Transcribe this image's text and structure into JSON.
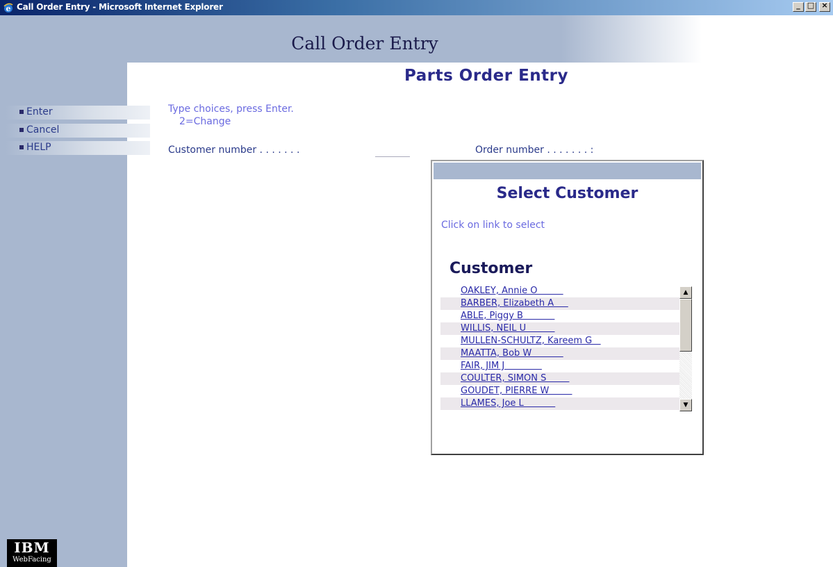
{
  "window": {
    "title": "Call Order Entry - Microsoft Internet Explorer",
    "minimize": "_",
    "maximize": "□",
    "close": "×"
  },
  "header": {
    "app_title": "Call Order Entry",
    "page_title": "Parts Order Entry"
  },
  "commands": [
    {
      "label": "Enter"
    },
    {
      "label": "Cancel"
    },
    {
      "label": "HELP"
    }
  ],
  "form": {
    "instruction_line1": "Type choices, press Enter.",
    "instruction_line2": "2=Change",
    "customer_number_label": "Customer number . . . . . . .",
    "customer_number_value": "",
    "order_number_label": "Order number . . . . . . . :"
  },
  "popup": {
    "title": "Select Customer",
    "instruction": "Click on link to select",
    "column_header": "Customer",
    "customers": [
      "OAKLEY, Annie O         ",
      "BARBER, Elizabeth A     ",
      "ABLE, Piggy B           ",
      "WILLIS, NEIL U          ",
      "MULLEN-SCHULTZ, Kareem G   ",
      "MAATTA, Bob W           ",
      "FAIR, JIM J             ",
      "COULTER, SIMON S        ",
      "GOUDET, PIERRE W        ",
      "LLAMES, Joe L           "
    ],
    "scroll_up": "▲",
    "scroll_down": "▼"
  },
  "logo": {
    "brand": "IBM",
    "product": "WebFacing"
  },
  "colors": {
    "sidebar": "#a8b7cf",
    "link": "#2a2aa8",
    "title": "#2a2a8a",
    "instruction": "#6a6ae0"
  }
}
